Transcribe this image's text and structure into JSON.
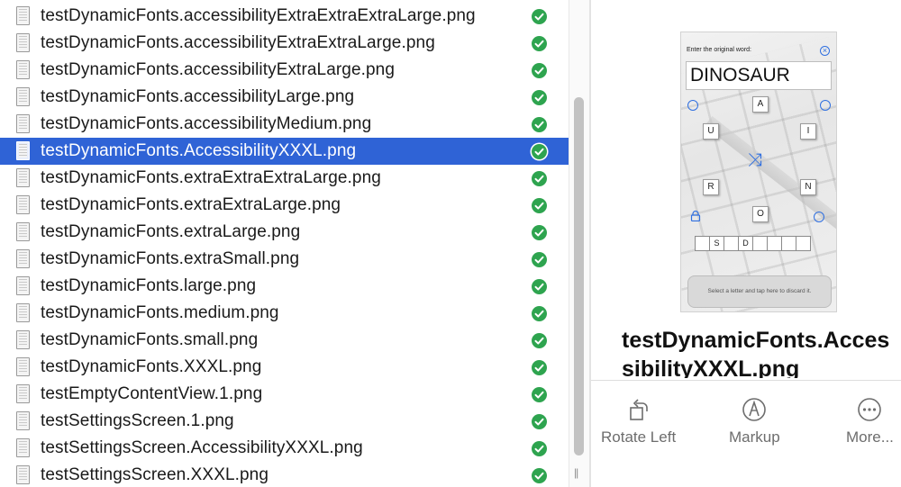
{
  "file_list": {
    "items": [
      {
        "name": "testDynamicFonts.accessibilityExtraExtraExtraLarge.png",
        "status": "synced",
        "selected": false
      },
      {
        "name": "testDynamicFonts.accessibilityExtraExtraLarge.png",
        "status": "synced",
        "selected": false
      },
      {
        "name": "testDynamicFonts.accessibilityExtraLarge.png",
        "status": "synced",
        "selected": false
      },
      {
        "name": "testDynamicFonts.accessibilityLarge.png",
        "status": "synced",
        "selected": false
      },
      {
        "name": "testDynamicFonts.accessibilityMedium.png",
        "status": "synced",
        "selected": false
      },
      {
        "name": "testDynamicFonts.AccessibilityXXXL.png",
        "status": "synced",
        "selected": true
      },
      {
        "name": "testDynamicFonts.extraExtraExtraLarge.png",
        "status": "synced",
        "selected": false
      },
      {
        "name": "testDynamicFonts.extraExtraLarge.png",
        "status": "synced",
        "selected": false
      },
      {
        "name": "testDynamicFonts.extraLarge.png",
        "status": "synced",
        "selected": false
      },
      {
        "name": "testDynamicFonts.extraSmall.png",
        "status": "synced",
        "selected": false
      },
      {
        "name": "testDynamicFonts.large.png",
        "status": "synced",
        "selected": false
      },
      {
        "name": "testDynamicFonts.medium.png",
        "status": "synced",
        "selected": false
      },
      {
        "name": "testDynamicFonts.small.png",
        "status": "synced",
        "selected": false
      },
      {
        "name": "testDynamicFonts.XXXL.png",
        "status": "synced",
        "selected": false
      },
      {
        "name": "testEmptyContentView.1.png",
        "status": "synced",
        "selected": false
      },
      {
        "name": "testSettingsScreen.1.png",
        "status": "synced",
        "selected": false
      },
      {
        "name": "testSettingsScreen.AccessibilityXXXL.png",
        "status": "synced",
        "selected": false
      },
      {
        "name": "testSettingsScreen.XXXL.png",
        "status": "synced",
        "selected": false
      }
    ]
  },
  "preview": {
    "title": "testDynamicFonts.AccessibilityXXXL.png",
    "thumbnail": {
      "prompt": "Enter the original word:",
      "word": "DINOSAUR",
      "tiles": [
        "A",
        "U",
        "I",
        "R",
        "N",
        "O"
      ],
      "slots": [
        "",
        "S",
        "",
        "D",
        "",
        "",
        "",
        ""
      ],
      "hint": "Select a letter and tap here to discard it."
    },
    "actions": [
      {
        "label": "Rotate Left",
        "icon": "rotate-left-icon"
      },
      {
        "label": "Markup",
        "icon": "markup-pen-icon"
      },
      {
        "label": "More...",
        "icon": "more-ellipsis-icon"
      }
    ]
  },
  "colors": {
    "selection": "#2f63d6",
    "status_ok": "#2ea44f",
    "accent": "#2f6fe0"
  }
}
